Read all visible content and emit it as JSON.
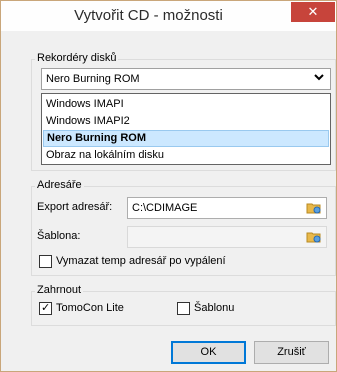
{
  "window": {
    "title": "Vytvořit CD - možnosti",
    "close_glyph": "✕"
  },
  "recorders": {
    "group_label": "Rekordéry disků",
    "selected": "Nero Burning ROM",
    "arrow": "⌄",
    "options": [
      "Windows IMAPI",
      "Windows IMAPI2",
      "Nero Burning ROM",
      "Obraz na lokálním disku"
    ],
    "highlighted_index": 2
  },
  "dirs": {
    "group_label": "Adresáře",
    "export_label": "Export adresář:",
    "export_value": "C:\\CDIMAGE",
    "template_label": "Šablona:",
    "template_value": "",
    "cleanup_label": "Vymazat temp adresář po vypálení",
    "cleanup_checked": false,
    "browse_icon": "folder-browse-icon"
  },
  "include": {
    "group_label": "Zahrnout",
    "tomocon_label": "TomoCon Lite",
    "tomocon_checked": true,
    "template_label": "Šablonu",
    "template_checked": false
  },
  "buttons": {
    "ok": "OK",
    "cancel": "Zrušiť"
  },
  "colors": {
    "close_bg": "#c7443b",
    "highlight": "#cce8ff",
    "accent": "#0078d7"
  }
}
